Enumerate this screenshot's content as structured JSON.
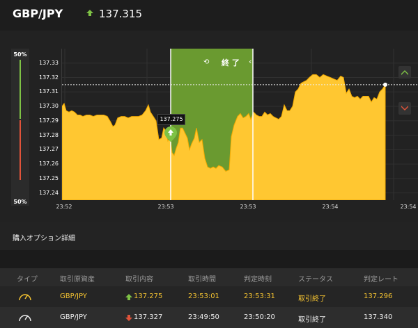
{
  "header": {
    "pair": "GBP/JPY",
    "price": "137.315"
  },
  "side_meter": {
    "top_label": "50%",
    "bottom_label": "50%",
    "close_label": "×"
  },
  "chart_data": {
    "type": "area",
    "y_ticks": [
      "137.33",
      "137.32",
      "137.31",
      "137.30",
      "137.29",
      "137.28",
      "137.27",
      "137.26",
      "137.25",
      "137.24"
    ],
    "x_ticks": [
      "23:52",
      "23:53",
      "23:53",
      "23:54",
      "23:54"
    ],
    "ylim": [
      137.235,
      137.34
    ],
    "current_price": 137.315,
    "entry": {
      "label": "137.275",
      "value": 137.275
    },
    "band_label": "終 了",
    "colors": {
      "area": "#ffc731",
      "band": "#6a9a30",
      "up": "#7ec245",
      "down": "#e0533a"
    },
    "points": [
      [
        0,
        137.3
      ],
      [
        3,
        137.302
      ],
      [
        6,
        137.297
      ],
      [
        10,
        137.296
      ],
      [
        14,
        137.297
      ],
      [
        18,
        137.296
      ],
      [
        22,
        137.294
      ],
      [
        26,
        137.294
      ],
      [
        30,
        137.293
      ],
      [
        35,
        137.294
      ],
      [
        40,
        137.294
      ],
      [
        45,
        137.293
      ],
      [
        50,
        137.294
      ],
      [
        55,
        137.294
      ],
      [
        60,
        137.294
      ],
      [
        65,
        137.293
      ],
      [
        70,
        137.289
      ],
      [
        73,
        137.286
      ],
      [
        76,
        137.287
      ],
      [
        80,
        137.292
      ],
      [
        85,
        137.293
      ],
      [
        90,
        137.293
      ],
      [
        95,
        137.292
      ],
      [
        100,
        137.293
      ],
      [
        105,
        137.293
      ],
      [
        110,
        137.293
      ],
      [
        115,
        137.294
      ],
      [
        120,
        137.297
      ],
      [
        124,
        137.301
      ],
      [
        127,
        137.296
      ],
      [
        131,
        137.293
      ],
      [
        135,
        137.29
      ],
      [
        139,
        137.277
      ],
      [
        143,
        137.278
      ],
      [
        146,
        137.285
      ],
      [
        149,
        137.283
      ],
      [
        152,
        137.276
      ],
      [
        155,
        137.279
      ],
      [
        158,
        137.268
      ],
      [
        161,
        137.266
      ],
      [
        164,
        137.271
      ],
      [
        167,
        137.275
      ],
      [
        170,
        137.285
      ],
      [
        173,
        137.285
      ],
      [
        177,
        137.281
      ],
      [
        180,
        137.278
      ],
      [
        183,
        137.27
      ],
      [
        186,
        137.274
      ],
      [
        190,
        137.278
      ],
      [
        193,
        137.285
      ],
      [
        197,
        137.275
      ],
      [
        201,
        137.277
      ],
      [
        205,
        137.264
      ],
      [
        209,
        137.258
      ],
      [
        213,
        137.257
      ],
      [
        217,
        137.258
      ],
      [
        221,
        137.257
      ],
      [
        225,
        137.259
      ],
      [
        230,
        137.258
      ],
      [
        235,
        137.255
      ],
      [
        240,
        137.256
      ],
      [
        243,
        137.279
      ],
      [
        247,
        137.287
      ],
      [
        252,
        137.293
      ],
      [
        256,
        137.295
      ],
      [
        260,
        137.292
      ],
      [
        264,
        137.293
      ],
      [
        268,
        137.295
      ],
      [
        271,
        137.291
      ],
      [
        275,
        137.296
      ],
      [
        279,
        137.294
      ],
      [
        283,
        137.293
      ],
      [
        287,
        137.293
      ],
      [
        291,
        137.296
      ],
      [
        295,
        137.294
      ],
      [
        299,
        137.295
      ],
      [
        303,
        137.293
      ],
      [
        307,
        137.292
      ],
      [
        311,
        137.291
      ],
      [
        315,
        137.293
      ],
      [
        319,
        137.301
      ],
      [
        323,
        137.297
      ],
      [
        327,
        137.297
      ],
      [
        331,
        137.3
      ],
      [
        335,
        137.31
      ],
      [
        339,
        137.312
      ],
      [
        343,
        137.316
      ],
      [
        347,
        137.317
      ],
      [
        351,
        137.318
      ],
      [
        355,
        137.32
      ],
      [
        360,
        137.322
      ],
      [
        365,
        137.322
      ],
      [
        370,
        137.32
      ],
      [
        375,
        137.322
      ],
      [
        380,
        137.321
      ],
      [
        385,
        137.32
      ],
      [
        390,
        137.319
      ],
      [
        395,
        137.318
      ],
      [
        400,
        137.321
      ],
      [
        404,
        137.32
      ],
      [
        408,
        137.309
      ],
      [
        412,
        137.312
      ],
      [
        416,
        137.307
      ],
      [
        420,
        137.306
      ],
      [
        424,
        137.307
      ],
      [
        428,
        137.305
      ],
      [
        432,
        137.307
      ],
      [
        436,
        137.307
      ],
      [
        440,
        137.307
      ],
      [
        444,
        137.303
      ],
      [
        448,
        137.306
      ],
      [
        452,
        137.305
      ],
      [
        456,
        137.31
      ],
      [
        460,
        137.312
      ],
      [
        464,
        137.315
      ]
    ]
  },
  "section": {
    "title": "購入オプション詳細"
  },
  "table": {
    "headers": [
      "タイプ",
      "取引原資産",
      "取引内容",
      "取引時間",
      "判定時刻",
      "ステータス",
      "判定レート"
    ],
    "rows": [
      [
        "GBP/JPY",
        "137.275",
        "23:53:01",
        "23:53:31",
        "取引終了",
        "137.296"
      ],
      [
        "GBP/JPY",
        "137.327",
        "23:49:50",
        "23:50:20",
        "取引終了",
        "137.340"
      ]
    ]
  }
}
